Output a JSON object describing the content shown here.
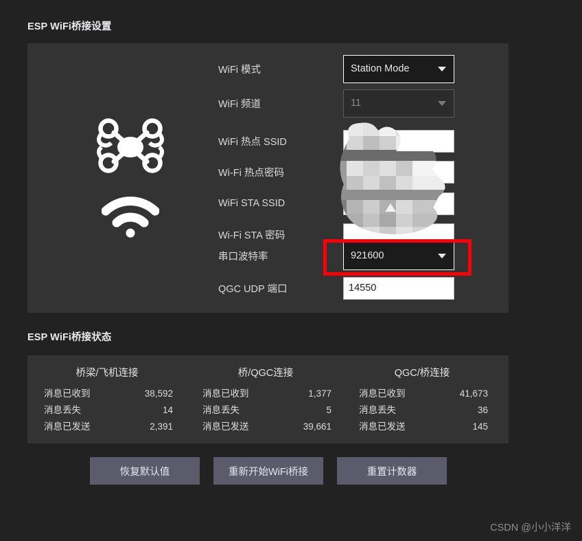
{
  "settings": {
    "heading": "ESP WiFi桥接设置",
    "rows": [
      {
        "label": "WiFi 模式",
        "control": "combo",
        "value": "Station Mode",
        "enabled": true
      },
      {
        "label": "WiFi 频道",
        "control": "combo",
        "value": "11",
        "enabled": false
      },
      {
        "label": "WiFi 热点 SSID",
        "control": "input",
        "value": "",
        "enabled": true
      },
      {
        "label": "Wi-Fi 热点密码",
        "control": "input",
        "value": "",
        "enabled": true
      },
      {
        "label": "WiFi STA SSID",
        "control": "input",
        "value": "",
        "enabled": true
      },
      {
        "label": "Wi-Fi STA 密码",
        "control": "input",
        "value": "",
        "enabled": true
      },
      {
        "label": "串口波特率",
        "control": "combo",
        "value": "921600",
        "enabled": true
      },
      {
        "label": "QGC UDP 端口",
        "control": "input",
        "value": "14550",
        "enabled": true
      }
    ]
  },
  "annotation": {
    "highlight_color": "#fb0007",
    "target": "串口波特率"
  },
  "status": {
    "heading": "ESP WiFi桥接状态",
    "groups": [
      {
        "title": "桥梁/飞机连接",
        "lines": [
          {
            "label": "消息已收到",
            "value": "38,592"
          },
          {
            "label": "消息丢失",
            "value": "14"
          },
          {
            "label": "消息已发送",
            "value": "2,391"
          }
        ]
      },
      {
        "title": "桥/QGC连接",
        "lines": [
          {
            "label": "消息已收到",
            "value": "1,377"
          },
          {
            "label": "消息丢失",
            "value": "5"
          },
          {
            "label": "消息已发送",
            "value": "39,661"
          }
        ]
      },
      {
        "title": "QGC/桥连接",
        "lines": [
          {
            "label": "消息已收到",
            "value": "41,673"
          },
          {
            "label": "消息丢失",
            "value": "36"
          },
          {
            "label": "消息已发送",
            "value": "145"
          }
        ]
      }
    ]
  },
  "actions": {
    "reset_defaults": "恢复默认值",
    "restart_bridge": "重新开始WiFi桥接",
    "reset_counters": "重置计数器"
  },
  "icons": {
    "drone": "drone-icon",
    "wifi": "wifi-icon"
  },
  "watermark": "CSDN @小小洋洋",
  "colors": {
    "page_background": "#222222",
    "panel_background": "#333333",
    "button_background": "#5b5b6c",
    "highlight": "#fb0007",
    "input_background": "#ffffff",
    "combo_background": "#1b1b1b"
  }
}
